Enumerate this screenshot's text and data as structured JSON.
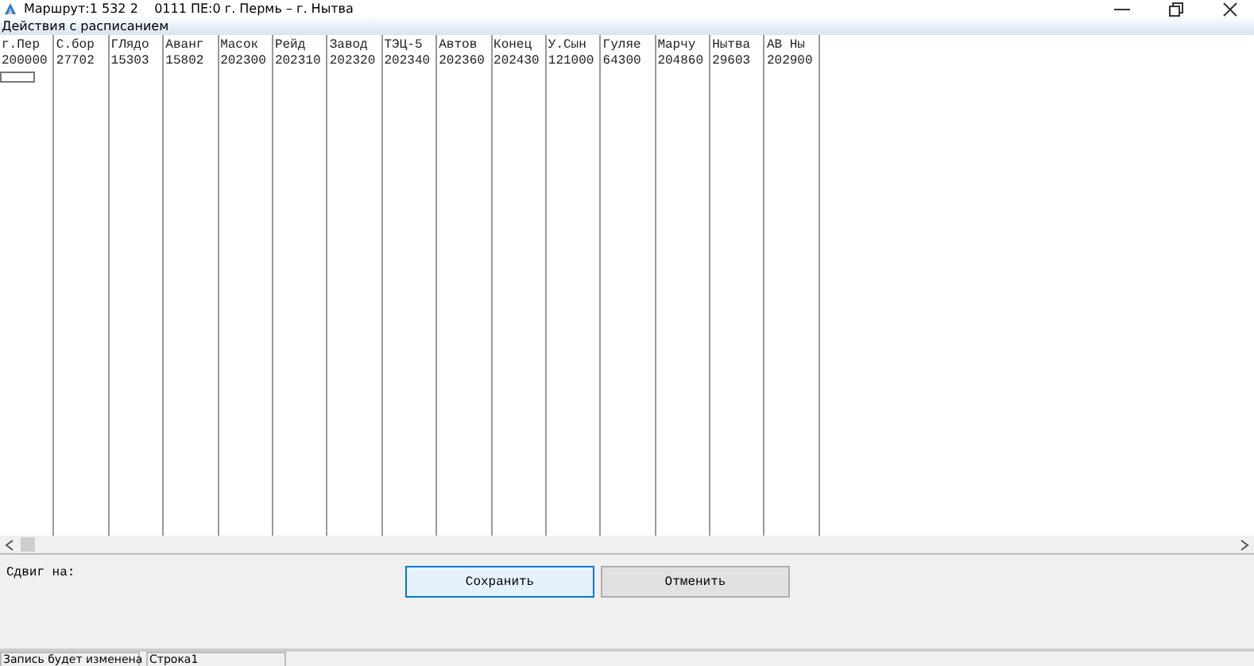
{
  "window": {
    "title": "Маршрут:1 532 2    0111 ПЕ:0 г. Пермь – г. Нытва"
  },
  "menu": [
    "Действия с расписанием"
  ],
  "table": {
    "columns": [
      {
        "header": "г.Пер",
        "value": "200000"
      },
      {
        "header": "С.бор",
        "value": "27702"
      },
      {
        "header": "ГЛядо",
        "value": "15303"
      },
      {
        "header": "Аванг",
        "value": "15802"
      },
      {
        "header": "Масок",
        "value": "202300"
      },
      {
        "header": "Рейд",
        "value": "202310"
      },
      {
        "header": "Завод",
        "value": "202320"
      },
      {
        "header": "ТЭЦ-5",
        "value": "202340"
      },
      {
        "header": "Автов",
        "value": "202360"
      },
      {
        "header": "Конец",
        "value": "202430"
      },
      {
        "header": "У.Сын",
        "value": "121000"
      },
      {
        "header": "Гуляе",
        "value": "64300"
      },
      {
        "header": "Марчу",
        "value": "204860"
      },
      {
        "header": "Нытва",
        "value": "29603"
      },
      {
        "header": "АВ Ны",
        "value": "202900"
      }
    ]
  },
  "shift_label": "Сдвиг на:",
  "buttons": [
    {
      "label": "Сохранить",
      "selected": true
    },
    {
      "label": "Отменить",
      "selected": false
    }
  ],
  "status_bar": [
    "Запись будет изменена",
    "Строка1"
  ]
}
